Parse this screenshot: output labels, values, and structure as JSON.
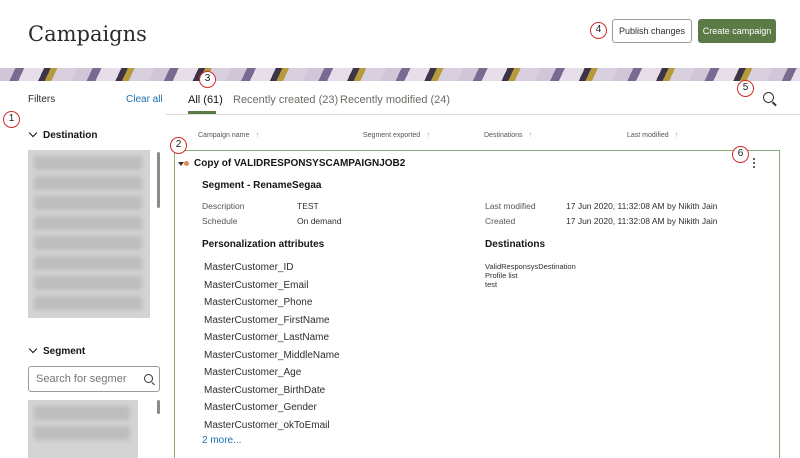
{
  "page": {
    "title": "Campaigns"
  },
  "header": {
    "publish_label": "Publish changes",
    "create_label": "Create campaign"
  },
  "badges": [
    "1",
    "2",
    "3",
    "4",
    "5",
    "6"
  ],
  "filters": {
    "label": "Filters",
    "clear_label": "Clear all",
    "destination_label": "Destination",
    "segment_label": "Segment",
    "segment_search_placeholder": "Search for segmer"
  },
  "tabs": [
    {
      "label": "All (61)"
    },
    {
      "label": "Recently created (23)"
    },
    {
      "label": "Recently modified (24)"
    }
  ],
  "columns": {
    "name": "Campaign name",
    "segment": "Segment exported",
    "destinations": "Destinations",
    "modified": "Last modified"
  },
  "campaign": {
    "title": "Copy of VALIDRESPONSYSCAMPAIGNJOB2",
    "segment_title": "Segment - RenameSegaa",
    "description_label": "Description",
    "description_value": "TEST",
    "schedule_label": "Schedule",
    "schedule_value": "On demand",
    "last_modified_label": "Last modified",
    "last_modified_value": "17 Jun 2020, 11:32:08 AM by Nikith Jain",
    "created_label": "Created",
    "created_value": "17 Jun 2020, 11:32:08 AM by Nikith Jain",
    "personalization_title": "Personalization attributes",
    "attributes": [
      "MasterCustomer_ID",
      "MasterCustomer_Email",
      "MasterCustomer_Phone",
      "MasterCustomer_FirstName",
      "MasterCustomer_LastName",
      "MasterCustomer_MiddleName",
      "MasterCustomer_Age",
      "MasterCustomer_BirthDate",
      "MasterCustomer_Gender",
      "MasterCustomer_okToEmail"
    ],
    "more_label": "2 more...",
    "destinations_title": "Destinations",
    "destinations": [
      "ValidResponsysDestination",
      "Profile list",
      "test"
    ]
  },
  "colors": {
    "accent": "#5a7a46",
    "link": "#1b6fb0",
    "badge_ring": "#d42b2b",
    "status_dot": "#e28a4c"
  }
}
